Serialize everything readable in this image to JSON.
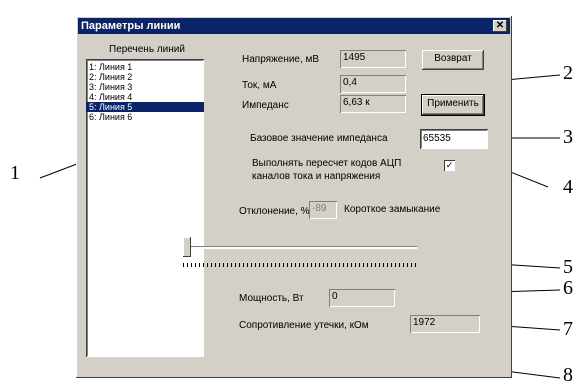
{
  "window": {
    "title": "Параметры линии",
    "close_glyph": "✕"
  },
  "list": {
    "header": "Перечень линий",
    "items": [
      "1: Линия 1",
      "2: Линия 2",
      "3: Линия 3",
      "4: Линия 4",
      "5: Линия 5",
      "6: Линия 6"
    ],
    "selected_index": 4
  },
  "voltage": {
    "label": "Напряжение, мВ",
    "value": "1495"
  },
  "current": {
    "label": "Ток, мА",
    "value": "0,4"
  },
  "impedance": {
    "label": "Импеданс",
    "value": "6,63 к"
  },
  "buttons": {
    "return": "Возврат",
    "apply": "Применить"
  },
  "base_impedance": {
    "label": "Базовое значение импеданса",
    "value": "65535"
  },
  "recalc": {
    "line1": "Выполнять пересчет кодов АЦП",
    "line2": "каналов тока и напряжения",
    "checked": true,
    "check_glyph": "✓"
  },
  "deviation": {
    "label": "Отклонение, %",
    "value": "-89",
    "status": "Короткое замыкание"
  },
  "slider": {
    "level": 0.0
  },
  "power": {
    "label": "Мощность, Вт",
    "value": "0"
  },
  "leakage": {
    "label": "Сопротивление утечки, кОм",
    "value": "1972"
  },
  "callouts": [
    "1",
    "2",
    "3",
    "4",
    "5",
    "6",
    "7",
    "8"
  ]
}
